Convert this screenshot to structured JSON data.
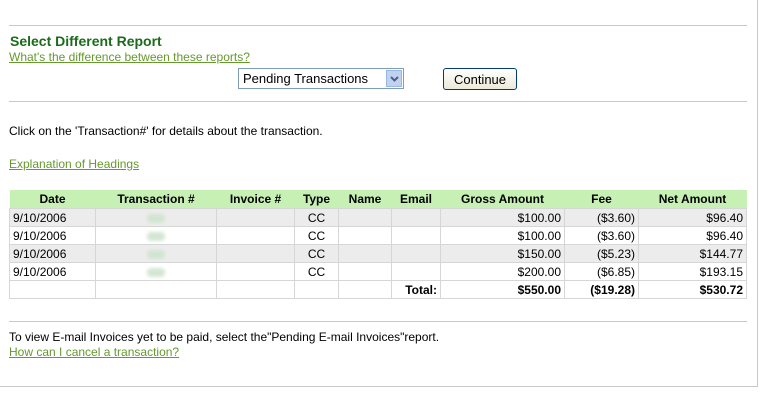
{
  "header": {
    "title": "Select Different Report",
    "difference_link": "What's the difference between these reports?"
  },
  "report_select": {
    "selected": "Pending Transactions"
  },
  "continue_label": "Continue",
  "instruction": "Click on the 'Transaction#' for details about the transaction.",
  "explanation_link": "Explanation of Headings",
  "table": {
    "headers": [
      "Date",
      "Transaction #",
      "Invoice #",
      "Type",
      "Name",
      "Email",
      "Gross Amount",
      "Fee",
      "Net Amount"
    ],
    "rows": [
      {
        "date": "9/10/2006",
        "type": "CC",
        "gross": "$100.00",
        "fee": "($3.60)",
        "net": "$96.40"
      },
      {
        "date": "9/10/2006",
        "type": "CC",
        "gross": "$100.00",
        "fee": "($3.60)",
        "net": "$96.40"
      },
      {
        "date": "9/10/2006",
        "type": "CC",
        "gross": "$150.00",
        "fee": "($5.23)",
        "net": "$144.77"
      },
      {
        "date": "9/10/2006",
        "type": "CC",
        "gross": "$200.00",
        "fee": "($6.85)",
        "net": "$193.15"
      }
    ],
    "total": {
      "label": "Total:",
      "gross": "$550.00",
      "fee": "($19.28)",
      "net": "$530.72"
    }
  },
  "footer": {
    "text": "To view E-mail Invoices yet to be paid, select the\"Pending E-mail Invoices\"report.",
    "cancel_link": "How can I cancel a transaction?"
  },
  "colors": {
    "title": "#1a6b1a",
    "link": "#66992e",
    "table_header": "#c6f0b4",
    "row_alt": "#ececec"
  },
  "icons": [
    "chevron-down-icon"
  ]
}
